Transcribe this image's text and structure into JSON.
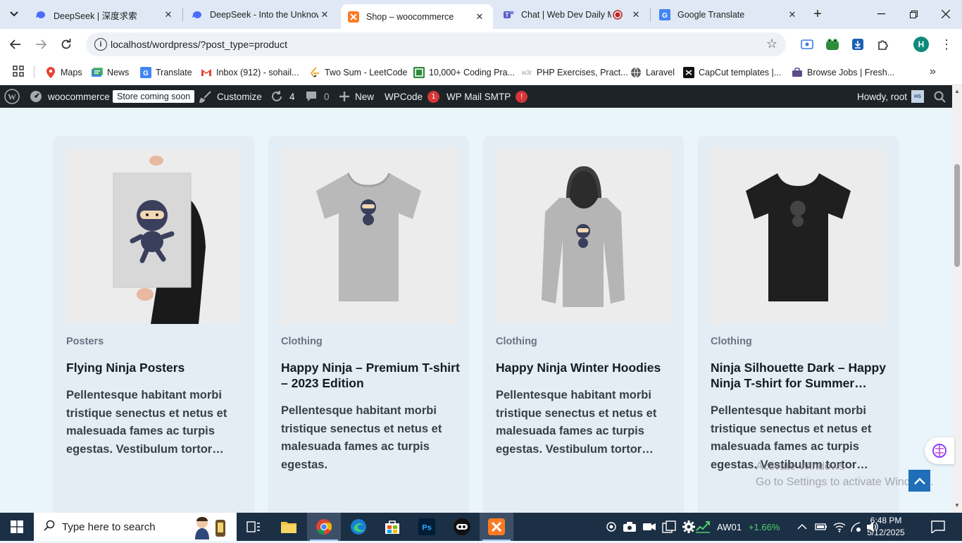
{
  "browser": {
    "tabs": [
      {
        "title": "DeepSeek | 深度求索",
        "active": false
      },
      {
        "title": "DeepSeek - Into the Unknown",
        "active": false
      },
      {
        "title": "Shop – woocommerce",
        "active": true
      },
      {
        "title": "Chat | Web Dev Daily Meeting",
        "active": false
      },
      {
        "title": "Google Translate",
        "active": false
      }
    ],
    "url": "localhost/wordpress/?post_type=product",
    "profile_initial": "H",
    "bookmarks": [
      {
        "label": "Maps"
      },
      {
        "label": "News"
      },
      {
        "label": "Translate"
      },
      {
        "label": "Inbox (912) - sohail..."
      },
      {
        "label": "Two Sum - LeetCode"
      },
      {
        "label": "10,000+ Coding Pra..."
      },
      {
        "label": "PHP Exercises, Pract..."
      },
      {
        "label": "Laravel"
      },
      {
        "label": "CapCut templates |..."
      },
      {
        "label": "Browse Jobs | Fresh..."
      }
    ]
  },
  "adminbar": {
    "site_name": "woocommerce",
    "store_badge": "Store coming soon",
    "customize": "Customize",
    "updates_count": "4",
    "comments_count": "0",
    "new_label": "New",
    "wpcode_label": "WPCode",
    "wpcode_badge": "1",
    "mail_label": "WP Mail SMTP",
    "mail_badge": "!",
    "howdy": "Howdy, root",
    "user_initials": "HS"
  },
  "products": [
    {
      "category": "Posters",
      "name": "Flying Ninja Posters",
      "description": "Pellentesque habitant morbi tristique senectus et netus et malesuada fames ac turpis egestas. Vestibulum tortor…"
    },
    {
      "category": "Clothing",
      "name": "Happy Ninja – Premium T-shirt – 2023 Edition",
      "description": "Pellentesque habitant morbi tristique senectus et netus et malesuada fames ac turpis egestas."
    },
    {
      "category": "Clothing",
      "name": "Happy Ninja Winter Hoodies",
      "description": "Pellentesque habitant morbi tristique senectus et netus et malesuada fames ac turpis egestas. Vestibulum tortor…"
    },
    {
      "category": "Clothing",
      "name": "Ninja Silhouette Dark – Happy Ninja T-shirt for Summer…",
      "description": "Pellentesque habitant morbi tristique senectus et netus et malesuada fames ac turpis egestas. Vestibulum tortor…"
    }
  ],
  "watermark": {
    "line1": "Activate Windows",
    "line2": "Go to Settings to activate Windows."
  },
  "taskbar": {
    "search_placeholder": "Type here to search",
    "stock_symbol": "AW01",
    "stock_change": "+1.66%",
    "time": "6:48 PM",
    "date": "5/12/2025"
  },
  "colors": {
    "accent": "#1e6fb8",
    "adminbar": "#1d2327",
    "badge": "#d63638",
    "stock_up": "#4fd06a"
  }
}
